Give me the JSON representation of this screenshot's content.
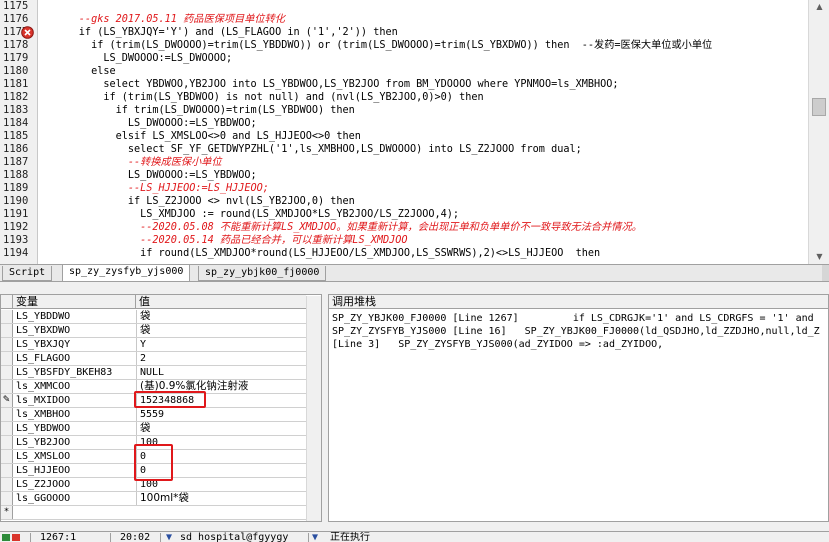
{
  "editor": {
    "line_numbers": [
      "1175",
      "1176",
      "1177",
      "1178",
      "1179",
      "1180",
      "1181",
      "1182",
      "1183",
      "1184",
      "1185",
      "1186",
      "1187",
      "1188",
      "1189",
      "1190",
      "1191",
      "1192",
      "1193",
      "1194"
    ],
    "lines": [
      {
        "text": "",
        "type": "code"
      },
      {
        "text": "      --gks 2017.05.11 药品医保项目单位转化",
        "type": "comment"
      },
      {
        "text": "      if (LS_YBXJQY='Y') and (LS_FLAGOO in ('1','2')) then",
        "type": "code"
      },
      {
        "text": "        if (trim(LS_DWOOOO)=trim(LS_YBDDWO)) or (trim(LS_DWOOOO)=trim(LS_YBXDWO)) then  --发药=医保大单位或小单位",
        "type": "code"
      },
      {
        "text": "          LS_DWOOOO:=LS_DWOOOO;",
        "type": "code"
      },
      {
        "text": "        else",
        "type": "code"
      },
      {
        "text": "          select YBDWOO,YB2JOO into LS_YBDWOO,LS_YB2JOO from BM_YDOOOO where YPNMOO=ls_XMBHOO;",
        "type": "code"
      },
      {
        "text": "          if (trim(LS_YBDWOO) is not null) and (nvl(LS_YB2JOO,0)>0) then",
        "type": "code"
      },
      {
        "text": "            if trim(LS_DWOOOO)=trim(LS_YBDWOO) then",
        "type": "code"
      },
      {
        "text": "              LS_DWOOOO:=LS_YBDWOO;",
        "type": "code"
      },
      {
        "text": "            elsif LS_XMSLOO<>0 and LS_HJJEOO<>0 then",
        "type": "code"
      },
      {
        "text": "              select SF_YF_GETDWYPZHL('1',ls_XMBHOO,LS_DWOOOO) into LS_Z2JOOO from dual;",
        "type": "code"
      },
      {
        "text": "              --转换成医保小单位",
        "type": "comment"
      },
      {
        "text": "              LS_DWOOOO:=LS_YBDWOO;",
        "type": "code"
      },
      {
        "text": "              --LS_HJJEOO:=LS_HJJEOO;",
        "type": "comment"
      },
      {
        "text": "              if LS_Z2JOOO <> nvl(LS_YB2JOO,0) then",
        "type": "code"
      },
      {
        "text": "                LS_XMDJOO := round(LS_XMDJOO*LS_YB2JOO/LS_Z2JOOO,4);",
        "type": "code"
      },
      {
        "text": "                --2020.05.08 不能重新计算LS_XMDJOO。如果重新计算，会出现正单和负单单价不一致导致无法合并情况。",
        "type": "comment"
      },
      {
        "text": "                --2020.05.14 药品已经合并，可以重新计算LS_XMDJOO",
        "type": "comment"
      },
      {
        "text": "                if round(LS_XMDJOO*round(LS_HJJEOO/LS_XMDJOO,LS_SSWRWS),2)<>LS_HJJEOO  then",
        "type": "code"
      }
    ]
  },
  "tabs": [
    {
      "label": "Script"
    },
    {
      "label": "sp_zy_zysfyb_yjs000"
    },
    {
      "label": "sp_zy_ybjk00_fj0000"
    }
  ],
  "variables": {
    "header_name": "变量",
    "header_value": "值",
    "rows": [
      {
        "name": "LS_YBDDWO",
        "value": "袋"
      },
      {
        "name": "LS_YBXDWO",
        "value": "袋"
      },
      {
        "name": "LS_YBXJQY",
        "value": "Y"
      },
      {
        "name": "LS_FLAGOO",
        "value": "2"
      },
      {
        "name": "LS_YBSFDY_BKEH83",
        "value": "NULL"
      },
      {
        "name": "ls_XMMCOO",
        "value": "(基)0.9%氯化钠注射液"
      },
      {
        "name": "ls_MXIDOO",
        "value": "152348868"
      },
      {
        "name": "ls_XMBHOO",
        "value": "5559"
      },
      {
        "name": "LS_YBDWOO",
        "value": "袋"
      },
      {
        "name": "LS_YB2JOO",
        "value": "100"
      },
      {
        "name": "LS_XMSLOO",
        "value": "0"
      },
      {
        "name": "LS_HJJEOO",
        "value": "0"
      },
      {
        "name": "LS_Z2JOOO",
        "value": "100"
      },
      {
        "name": "ls_GGOOOO",
        "value": "100ml*袋"
      }
    ],
    "new_row_indicator": "*"
  },
  "callstack": {
    "header": "调用堆栈",
    "rows": [
      "SP_ZY_YBJK00_FJ0000 [Line 1267]         if LS_CDRGJK='1' and LS_CDRGFS = '1' and",
      "SP_ZY_ZYSFYB_YJS000 [Line 16]   SP_ZY_YBJK00_FJ0000(ld_QSDJHO,ld_ZZDJHO,null,ld_Z",
      "[Line 3]   SP_ZY_ZYSFYB_YJS000(ad_ZYIDOO => :ad_ZYIDOO,"
    ]
  },
  "statusbar": {
    "position": "1267:1",
    "time": "20:02",
    "connection": "sd_hospital@fgyygy",
    "state": "正在执行"
  },
  "colors": {
    "comment": "#e0181b",
    "highlight_box": "#e0181b",
    "breakpoint": "#d9342b"
  }
}
